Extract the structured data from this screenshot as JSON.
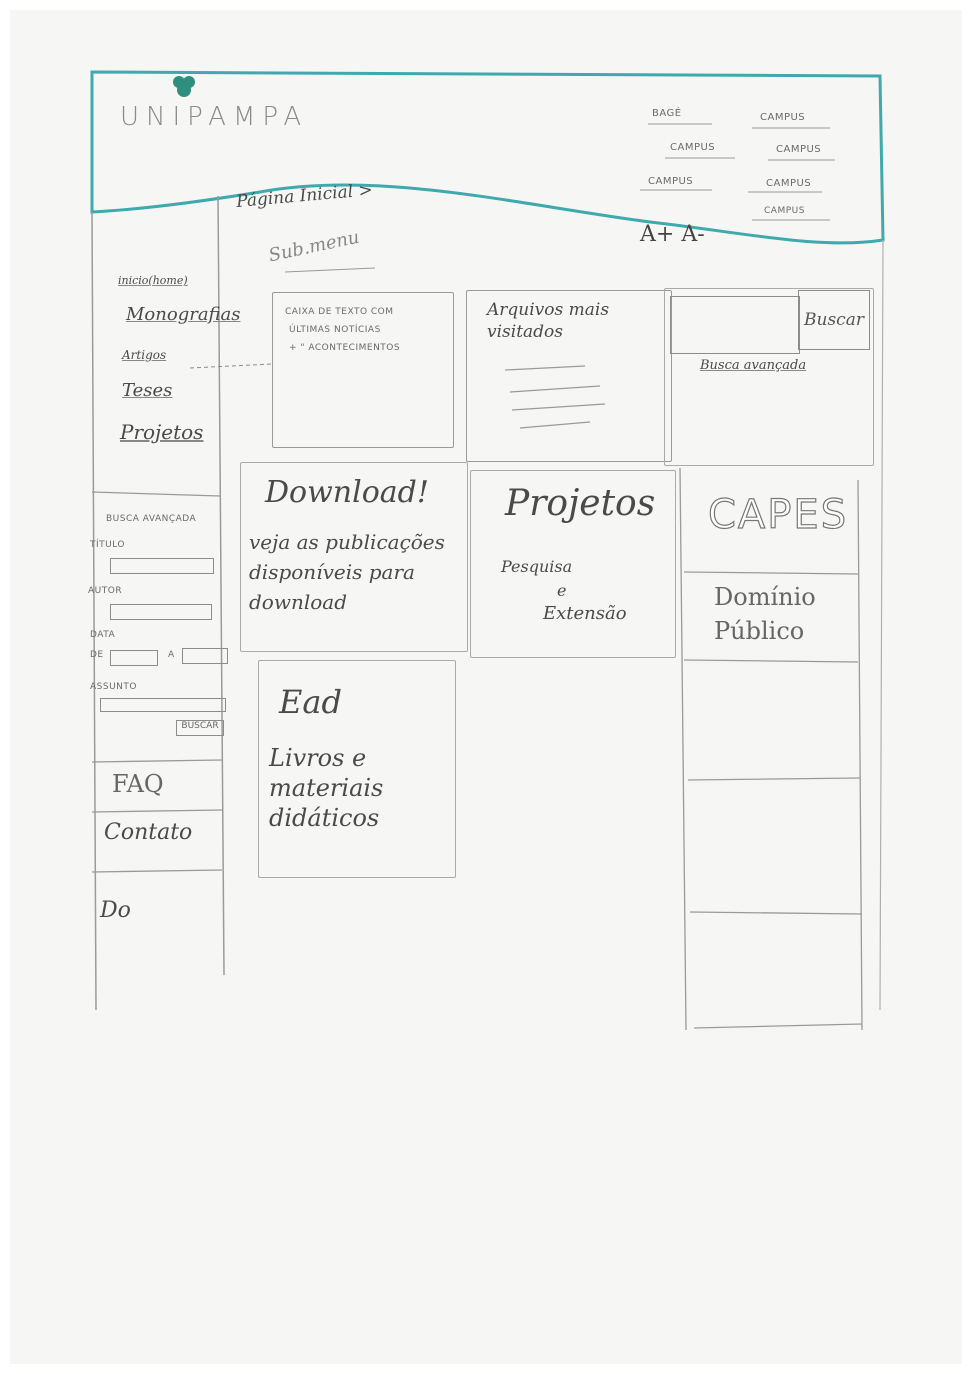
{
  "header": {
    "logo_text": "UNIPAMPA",
    "campus_links": [
      "BAGÉ",
      "CAMPUS",
      "CAMPUS",
      "CAMPUS",
      "CAMPUS",
      "CAMPUS",
      "CAMPUS"
    ],
    "font_controls": "A+ A-"
  },
  "breadcrumb": {
    "label": "Página Inicial >"
  },
  "submenu": {
    "label": "Sub.menu"
  },
  "sidebar": {
    "items": [
      {
        "label": "inicio(home)"
      },
      {
        "label": "Monografias"
      },
      {
        "label": "Artigos"
      },
      {
        "label": "Teses"
      },
      {
        "label": "Projetos"
      }
    ],
    "advanced_search": {
      "title": "BUSCA AVANÇADA",
      "titulo_label": "TÍTULO",
      "autor_label": "AUTOR",
      "data_label": "DATA",
      "de_label": "DE",
      "a_label": "A",
      "assunto_label": "ASSUNTO",
      "button_label": "BUSCAR"
    },
    "faq_label": "FAQ",
    "contact_label": "Contato",
    "last_label": "Do"
  },
  "news_box": {
    "line1": "CAIXA DE TEXTO COM",
    "line2": "ÚLTIMAS NOTÍCIAS",
    "line3": "+ \" ACONTECIMENTOS"
  },
  "most_visited": {
    "title": "Arquivos mais visitados"
  },
  "search": {
    "button_label": "Buscar",
    "advanced_link": "Busca avançada"
  },
  "download_box": {
    "title": "Download!",
    "text": "veja as publicações disponíveis para download"
  },
  "projects_box": {
    "title": "Projetos",
    "line1": "Pesquisa",
    "line2": "e",
    "line3": "Extensão"
  },
  "ead_box": {
    "title": "Ead",
    "text": "Livros e materiais didáticos"
  },
  "right_column": {
    "capes": "CAPES",
    "dominio_publico": "Domínio Público"
  },
  "colors": {
    "header_accent": "#3fa9ad",
    "logo_icon": "#2e8f7e",
    "pencil": "#8c8c8c"
  }
}
